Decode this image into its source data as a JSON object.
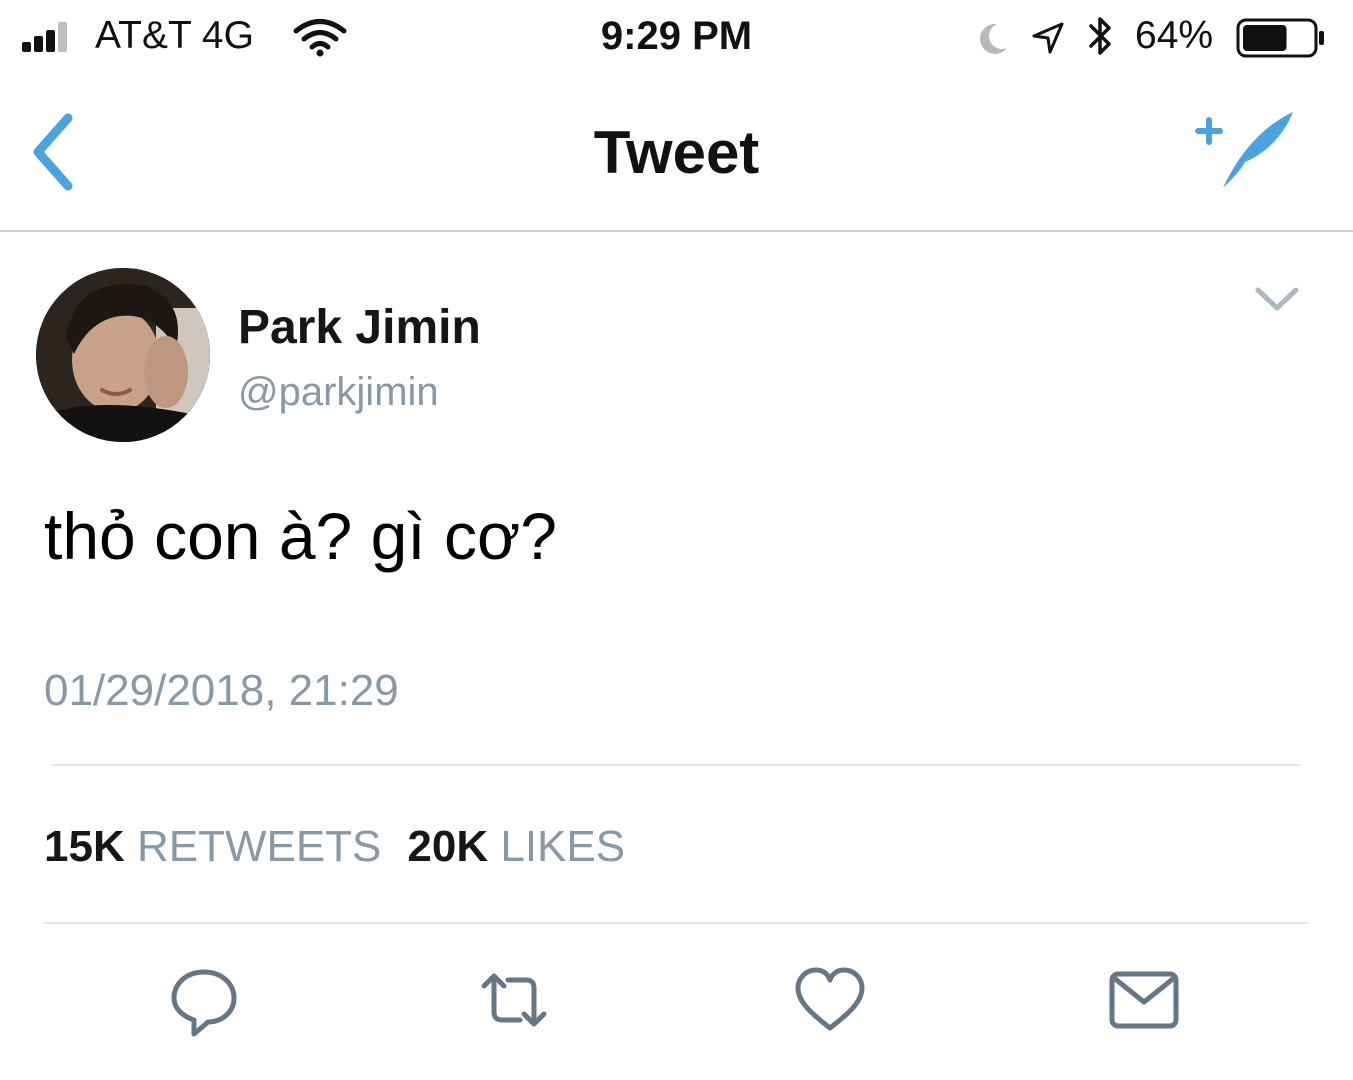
{
  "status_bar": {
    "carrier": "AT&T 4G",
    "time": "9:29 PM",
    "battery_percent": "64%",
    "battery_level": 0.64,
    "icons": [
      "signal-bars-icon",
      "wifi-icon",
      "moon-icon",
      "location-arrow-icon",
      "bluetooth-icon",
      "battery-icon"
    ]
  },
  "nav": {
    "title": "Tweet",
    "back_icon": "back-chevron-icon",
    "compose_icon": "compose-tweet-icon"
  },
  "tweet": {
    "display_name": "Park Jimin",
    "handle": "@parkjimin",
    "text": "thỏ con à? gì cơ?",
    "timestamp": "01/29/2018, 21:29",
    "menu_icon": "chevron-down-icon"
  },
  "stats": {
    "retweets_count": "15K",
    "retweets_label": "RETWEETS",
    "likes_count": "20K",
    "likes_label": "LIKES"
  },
  "actions": {
    "icons": [
      "reply-icon",
      "retweet-icon",
      "like-icon",
      "direct-message-icon"
    ]
  },
  "colors": {
    "accent": "#4aa3df",
    "text_primary": "#14171a",
    "text_secondary": "#8899a6",
    "divider": "#e1e8ed"
  }
}
